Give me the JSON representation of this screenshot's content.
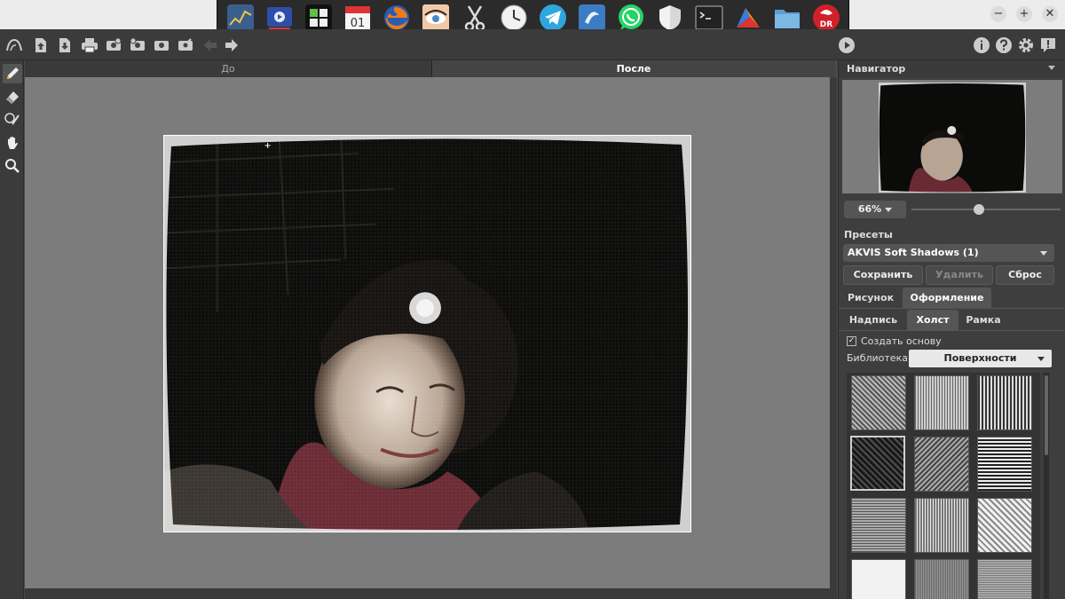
{
  "window": {
    "minimize_glyph": "−",
    "maximize_glyph": "+",
    "close_glyph": "✕"
  },
  "dock": {
    "icons": [
      "system-monitor-icon",
      "video-editor-icon",
      "app-grid-icon",
      "calendar-icon",
      "firefox-icon",
      "eye-app-icon",
      "scissors-icon",
      "clock-icon",
      "telegram-icon",
      "shotwell-icon",
      "whatsapp-icon",
      "shield-icon",
      "terminal-icon",
      "mail-app-icon",
      "folder-icon",
      "dr-icon"
    ],
    "calendar_day": "01",
    "dr_label": "DR"
  },
  "toolbar": {
    "icons": [
      "akvis-logo-icon",
      "open-icon",
      "save-icon",
      "print-icon",
      "batch-icon",
      "plugin-icon",
      "settings2-icon",
      "share-icon",
      "back-arrow-icon",
      "forward-arrow-icon",
      "run-icon",
      "info-icon",
      "help-icon",
      "gear-icon",
      "notification-icon"
    ]
  },
  "view_tabs": {
    "before": "До",
    "after": "После"
  },
  "navigator": {
    "title": "Навигатор",
    "zoom": "66%",
    "zoom_fraction": 0.6
  },
  "presets": {
    "title": "Пресеты",
    "selected": "AKVIS Soft Shadows (1)",
    "save": "Сохранить",
    "delete": "Удалить",
    "reset": "Сброс"
  },
  "main_tabs": [
    "Рисунок",
    "Оформление"
  ],
  "sub_tabs": [
    "Надпись",
    "Холст",
    "Рамка"
  ],
  "canvas_settings": {
    "create_base": "Создать основу",
    "create_base_checked": true,
    "check_glyph": "✓",
    "library_label": "Библиотека",
    "library_value": "Поверхности"
  },
  "colors": {
    "accent_red": "#d0202a",
    "panel_bg": "#3e3e3e",
    "canvas_bg": "#7c7c7c"
  }
}
